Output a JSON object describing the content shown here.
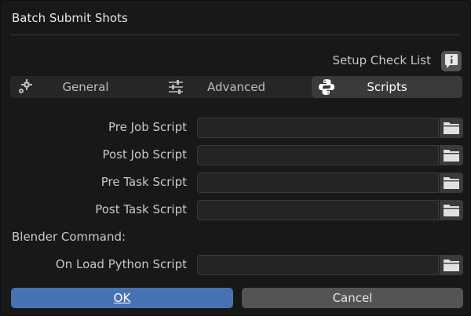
{
  "window": {
    "title": "Batch Submit Shots"
  },
  "setup_check": {
    "label": "Setup Check List",
    "icon": "info-icon"
  },
  "tabs": [
    {
      "label": "General",
      "icon": "gear-icon",
      "active": false
    },
    {
      "label": "Advanced",
      "icon": "sliders-icon",
      "active": false
    },
    {
      "label": "Scripts",
      "icon": "python-icon",
      "active": true
    }
  ],
  "scripts": {
    "pre_job": {
      "label": "Pre Job Script",
      "value": ""
    },
    "post_job": {
      "label": "Post Job Script",
      "value": ""
    },
    "pre_task": {
      "label": "Pre Task Script",
      "value": ""
    },
    "post_task": {
      "label": "Post Task Script",
      "value": ""
    }
  },
  "blender_command": {
    "section_label": "Blender Command:",
    "on_load": {
      "label": "On Load Python Script",
      "value": ""
    }
  },
  "buttons": {
    "ok": "OK",
    "cancel": "Cancel"
  },
  "colors": {
    "accent": "#4772b3",
    "background": "#181818",
    "field": "#242424"
  }
}
